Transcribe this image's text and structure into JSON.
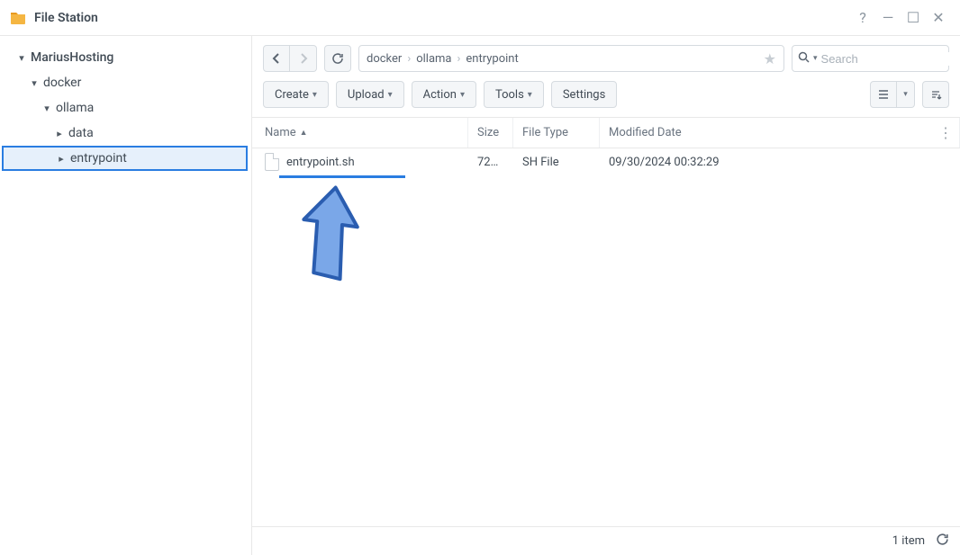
{
  "app": {
    "title": "File Station"
  },
  "tree": {
    "root": "MariusHosting",
    "l2": "docker",
    "l3": "ollama",
    "l4a": "data",
    "l4b": "entrypoint"
  },
  "breadcrumb": {
    "c1": "docker",
    "c2": "ollama",
    "c3": "entrypoint"
  },
  "search": {
    "placeholder": "Search"
  },
  "toolbar": {
    "create": "Create",
    "upload": "Upload",
    "action": "Action",
    "tools": "Tools",
    "settings": "Settings"
  },
  "columns": {
    "name": "Name",
    "size": "Size",
    "type": "File Type",
    "date": "Modified Date"
  },
  "rows": [
    {
      "name": "entrypoint.sh",
      "size": "72…",
      "type": "SH File",
      "date": "09/30/2024 00:32:29"
    }
  ],
  "status": {
    "count": "1 item"
  }
}
